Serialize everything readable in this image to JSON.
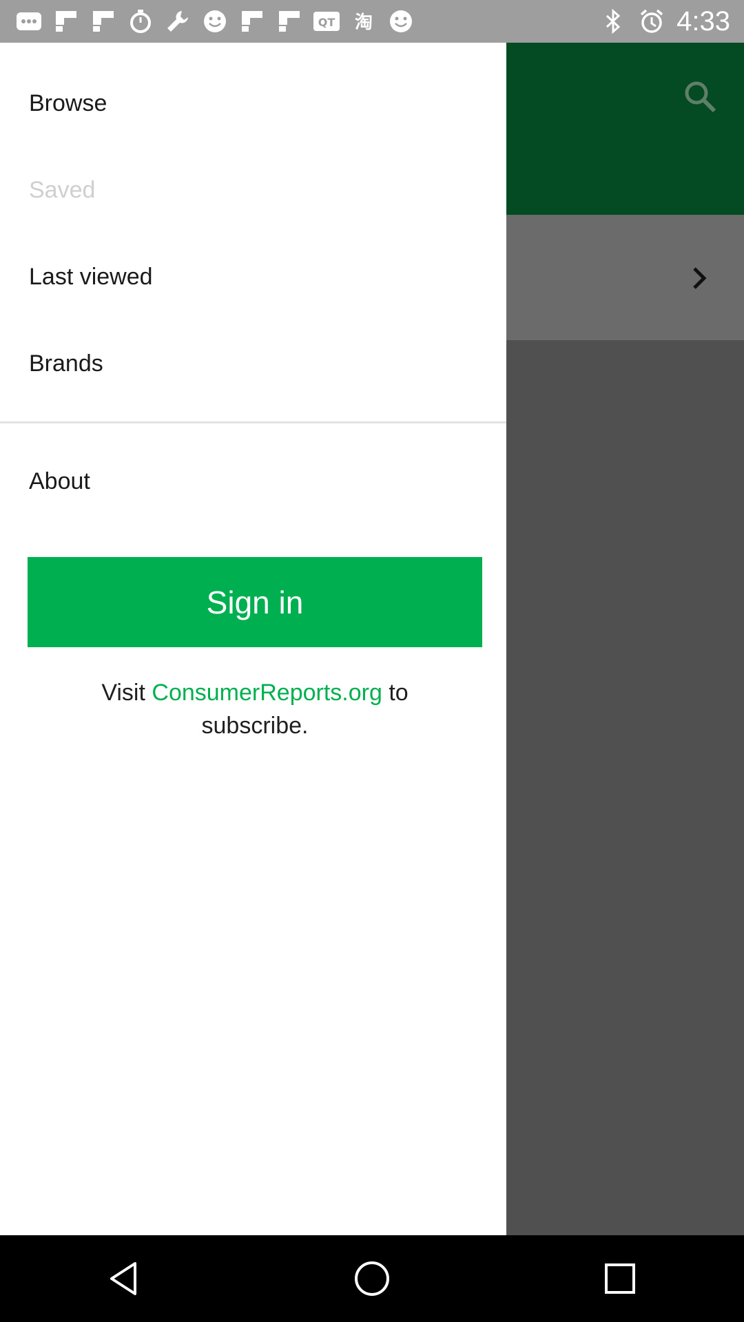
{
  "status_bar": {
    "time": "4:33",
    "icons": [
      "messages-icon",
      "flipboard-icon",
      "flipboard-icon",
      "stopwatch-icon",
      "wrench-icon",
      "smiley-icon",
      "flipboard-icon",
      "flipboard-icon",
      "qt-icon",
      "taobao-icon",
      "smiley-icon",
      "bluetooth-icon",
      "alarm-icon"
    ]
  },
  "drawer": {
    "items": [
      {
        "label": "Browse",
        "enabled": true
      },
      {
        "label": "Saved",
        "enabled": false
      },
      {
        "label": "Last viewed",
        "enabled": true
      },
      {
        "label": "Brands",
        "enabled": true
      },
      {
        "label": "About",
        "enabled": true
      }
    ],
    "signin_label": "Sign in",
    "visit": {
      "prefix": "Visit ",
      "link": "ConsumerReports.org",
      "suffix": " to subscribe."
    }
  },
  "colors": {
    "accent": "#00b050",
    "header": "#044a22",
    "scrim": "#505050"
  },
  "nav_bar": {
    "icons": [
      "back-icon",
      "home-icon",
      "recents-icon"
    ]
  }
}
